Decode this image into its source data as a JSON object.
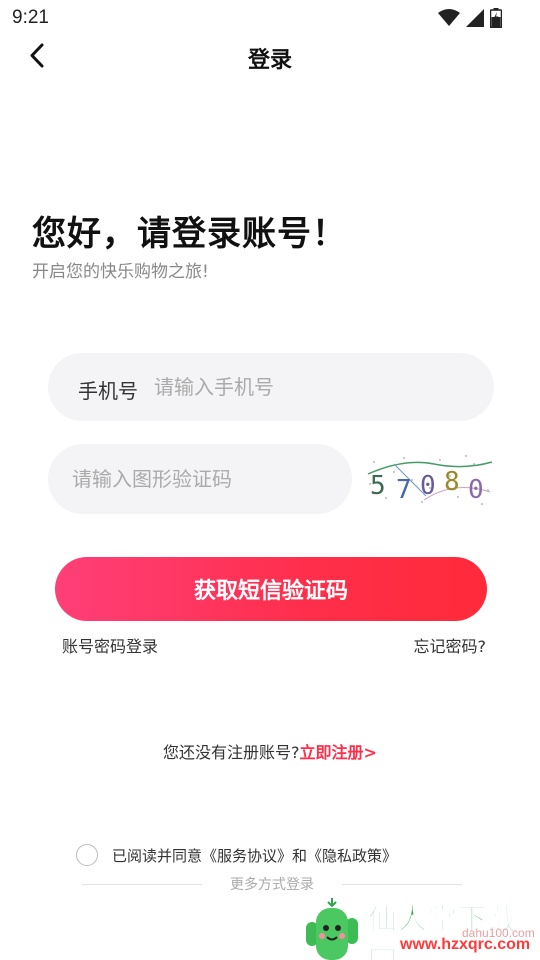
{
  "status_bar": {
    "time": "9:21"
  },
  "nav": {
    "title": "登录"
  },
  "greeting": {
    "title": "您好，请登录账号！",
    "subtitle": "开启您的快乐购物之旅!"
  },
  "form": {
    "phone_label": "手机号",
    "phone_placeholder": "请输入手机号",
    "captcha_placeholder": "请输入图形验证码",
    "captcha_chars": [
      "5",
      "7",
      "0",
      "8",
      "0"
    ],
    "submit_label": "获取短信验证码",
    "password_login": "账号密码登录",
    "forgot_password": "忘记密码?"
  },
  "register": {
    "prompt": "您还没有注册账号?",
    "link": "立即注册>"
  },
  "agreement": {
    "text": "已阅读并同意《服务协议》和《隐私政策》"
  },
  "more_login": {
    "label": "更多方式登录"
  },
  "watermark": {
    "brand": "仙人掌下载网",
    "url": "www.hzxqrc.com",
    "url_faint": "dahu100.com"
  },
  "colors": {
    "accent": "#ff2e4a",
    "gradient_start": "#ff3f79",
    "field_bg": "#f4f4f6"
  }
}
